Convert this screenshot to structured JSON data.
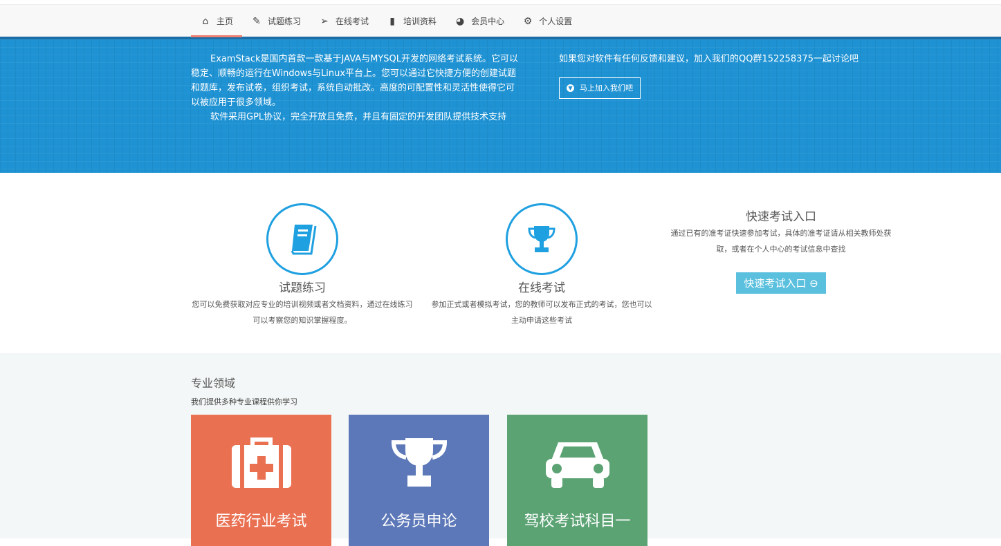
{
  "nav": {
    "items": [
      {
        "label": "主页",
        "icon": "home-icon",
        "glyph": "⌂",
        "active": true
      },
      {
        "label": "试题练习",
        "icon": "edit-icon",
        "glyph": "✎"
      },
      {
        "label": "在线考试",
        "icon": "paper-plane-icon",
        "glyph": "➢"
      },
      {
        "label": "培训资料",
        "icon": "book-icon",
        "glyph": "▮"
      },
      {
        "label": "会员中心",
        "icon": "dashboard-icon",
        "glyph": "◕"
      },
      {
        "label": "个人设置",
        "icon": "cogs-icon",
        "glyph": "⚙"
      }
    ]
  },
  "banner": {
    "para1": "ExamStack是国内首款一款基于JAVA与MYSQL开发的网络考试系统。它可以稳定、顺畅的运行在Windows与Linux平台上。您可以通过它快捷方便的创建试题和题库，发布试卷，组织考试，系统自动批改。高度的可配置性和灵活性使得它可以被应用于很多领域。",
    "para2": "软件采用GPL协议，完全开放且免费，并且有固定的开发团队提供技术支持",
    "feedback": "如果您对软件有任何反馈和建议，加入我们的QQ群152258375一起讨论吧",
    "join_button": "马上加入我们吧"
  },
  "features": {
    "practice": {
      "title": "试题练习",
      "desc": "您可以免费获取对应专业的培训视频或者文档资料，通过在线练习可以考察您的知识掌握程度。"
    },
    "exam": {
      "title": "在线考试",
      "desc": "参加正式或者模拟考试，您的教师可以发布正式的考试，您也可以主动申请这些考试"
    },
    "quick": {
      "title": "快速考试入口",
      "desc": "通过已有的准考证快速参加考试，具体的准考证请从相关教师处获取，或者在个人中心的考试信息中查找",
      "button": "快速考试入口"
    }
  },
  "fields": {
    "title": "专业领域",
    "subtitle": "我们提供多种专业课程供你学习",
    "cards": [
      {
        "label": "医药行业考试",
        "color": "#ea7052"
      },
      {
        "label": "公务员申论",
        "color": "#5d78b8"
      },
      {
        "label": "驾校考试科目一",
        "color": "#5ca374"
      }
    ]
  }
}
